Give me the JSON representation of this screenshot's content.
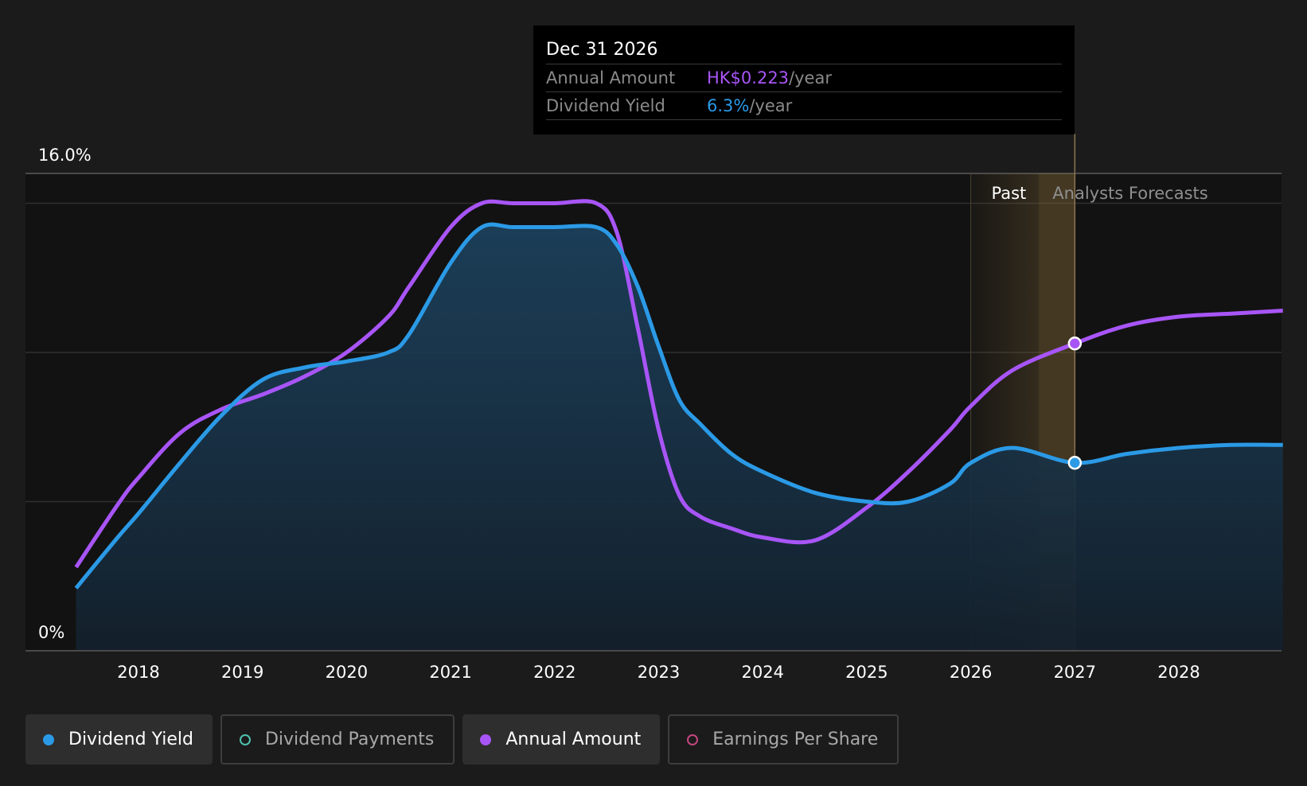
{
  "colors": {
    "background": "#1b1b1b",
    "dividend_yield": "#2b9ae6",
    "annual_amount": "#a855f7",
    "dividend_payments": "#4fc1b0",
    "earnings_per_share": "#c2477f",
    "forecast_band": "#8a6d3b"
  },
  "tooltip": {
    "date": "Dec 31 2026",
    "rows": [
      {
        "label": "Annual Amount",
        "value": "HK$0.223",
        "unit": "/year"
      },
      {
        "label": "Dividend Yield",
        "value": "6.3%",
        "unit": "/year"
      }
    ]
  },
  "chart_data": {
    "type": "line",
    "y_axis": {
      "top_label": "16.0%",
      "bottom_label": "0%",
      "range": [
        0,
        16
      ]
    },
    "x_ticks": [
      "2018",
      "2019",
      "2020",
      "2021",
      "2022",
      "2023",
      "2024",
      "2025",
      "2026",
      "2027",
      "2028"
    ],
    "x_range": [
      2017.4,
      2029.0
    ],
    "past_label": "Past",
    "forecast_label": "Analysts Forecasts",
    "forecast_band": [
      2026.0,
      2027.0
    ],
    "series": [
      {
        "name": "Annual Amount",
        "points": [
          [
            2017.4,
            2.8
          ],
          [
            2017.8,
            4.9
          ],
          [
            2018.0,
            5.8
          ],
          [
            2018.4,
            7.3
          ],
          [
            2018.8,
            8.1
          ],
          [
            2019.2,
            8.6
          ],
          [
            2019.6,
            9.2
          ],
          [
            2020.0,
            10.0
          ],
          [
            2020.4,
            11.2
          ],
          [
            2020.6,
            12.2
          ],
          [
            2021.0,
            14.2
          ],
          [
            2021.3,
            15.0
          ],
          [
            2021.6,
            15.0
          ],
          [
            2022.0,
            15.0
          ],
          [
            2022.4,
            15.0
          ],
          [
            2022.6,
            14.0
          ],
          [
            2022.8,
            10.8
          ],
          [
            2023.0,
            7.4
          ],
          [
            2023.2,
            5.2
          ],
          [
            2023.4,
            4.5
          ],
          [
            2023.7,
            4.1
          ],
          [
            2024.0,
            3.8
          ],
          [
            2024.5,
            3.7
          ],
          [
            2025.0,
            4.8
          ],
          [
            2025.4,
            6.0
          ],
          [
            2025.8,
            7.4
          ],
          [
            2026.0,
            8.2
          ],
          [
            2026.4,
            9.4
          ],
          [
            2027.0,
            10.3
          ],
          [
            2027.5,
            10.9
          ],
          [
            2028.0,
            11.2
          ],
          [
            2028.5,
            11.3
          ],
          [
            2029.0,
            11.4
          ]
        ]
      },
      {
        "name": "Dividend Yield",
        "points": [
          [
            2017.4,
            2.1
          ],
          [
            2017.8,
            3.8
          ],
          [
            2018.0,
            4.6
          ],
          [
            2018.4,
            6.3
          ],
          [
            2018.8,
            7.9
          ],
          [
            2019.2,
            9.1
          ],
          [
            2019.6,
            9.5
          ],
          [
            2020.0,
            9.7
          ],
          [
            2020.4,
            10.0
          ],
          [
            2020.6,
            10.6
          ],
          [
            2021.0,
            13.0
          ],
          [
            2021.3,
            14.2
          ],
          [
            2021.6,
            14.2
          ],
          [
            2022.0,
            14.2
          ],
          [
            2022.4,
            14.2
          ],
          [
            2022.6,
            13.6
          ],
          [
            2022.8,
            12.2
          ],
          [
            2023.0,
            10.2
          ],
          [
            2023.2,
            8.4
          ],
          [
            2023.4,
            7.6
          ],
          [
            2023.7,
            6.6
          ],
          [
            2024.0,
            6.0
          ],
          [
            2024.5,
            5.3
          ],
          [
            2025.0,
            5.0
          ],
          [
            2025.4,
            5.0
          ],
          [
            2025.8,
            5.6
          ],
          [
            2026.0,
            6.3
          ],
          [
            2026.4,
            6.8
          ],
          [
            2027.0,
            6.3
          ],
          [
            2027.5,
            6.6
          ],
          [
            2028.0,
            6.8
          ],
          [
            2028.5,
            6.9
          ],
          [
            2029.0,
            6.9
          ]
        ]
      }
    ]
  },
  "legend": [
    {
      "label": "Dividend Yield",
      "active": true,
      "filled": true,
      "color": "#2b9ae6"
    },
    {
      "label": "Dividend Payments",
      "active": false,
      "filled": false,
      "color": "#4fc1b0"
    },
    {
      "label": "Annual Amount",
      "active": true,
      "filled": true,
      "color": "#a855f7"
    },
    {
      "label": "Earnings Per Share",
      "active": false,
      "filled": false,
      "color": "#c2477f"
    }
  ]
}
